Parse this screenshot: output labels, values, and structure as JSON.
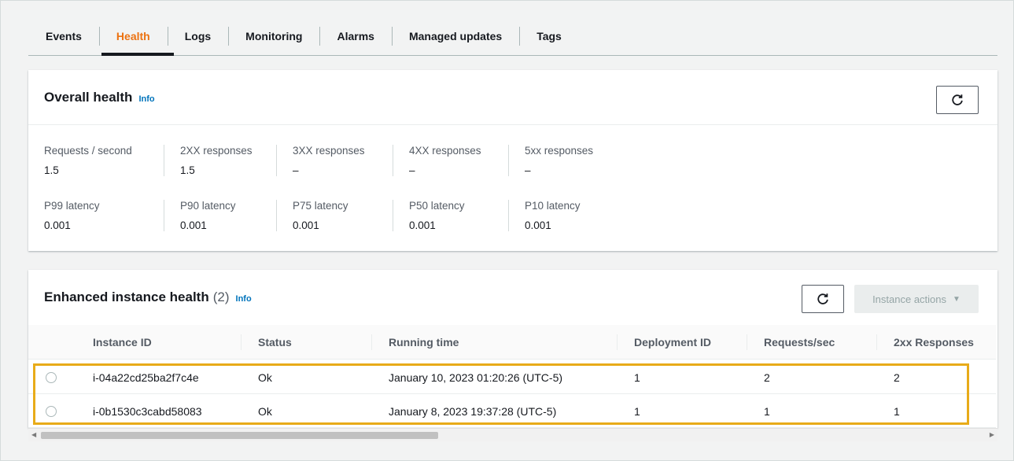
{
  "tabs": [
    {
      "label": "Events"
    },
    {
      "label": "Health"
    },
    {
      "label": "Logs"
    },
    {
      "label": "Monitoring"
    },
    {
      "label": "Alarms"
    },
    {
      "label": "Managed updates"
    },
    {
      "label": "Tags"
    }
  ],
  "overall": {
    "title": "Overall health",
    "info": "Info",
    "metrics_row1": [
      {
        "label": "Requests / second",
        "value": "1.5"
      },
      {
        "label": "2XX responses",
        "value": "1.5"
      },
      {
        "label": "3XX responses",
        "value": "–"
      },
      {
        "label": "4XX responses",
        "value": "–"
      },
      {
        "label": "5xx responses",
        "value": "–"
      }
    ],
    "metrics_row2": [
      {
        "label": "P99 latency",
        "value": "0.001"
      },
      {
        "label": "P90 latency",
        "value": "0.001"
      },
      {
        "label": "P75 latency",
        "value": "0.001"
      },
      {
        "label": "P50 latency",
        "value": "0.001"
      },
      {
        "label": "P10 latency",
        "value": "0.001"
      }
    ]
  },
  "enhanced": {
    "title": "Enhanced instance health",
    "count": "(2)",
    "info": "Info",
    "actions_label": "Instance actions",
    "columns": [
      "Instance ID",
      "Status",
      "Running time",
      "Deployment ID",
      "Requests/sec",
      "2xx Responses"
    ],
    "rows": [
      [
        "i-04a22cd25ba2f7c4e",
        "Ok",
        "January 10, 2023 01:20:26 (UTC-5)",
        "1",
        "2",
        "2"
      ],
      [
        "i-0b1530c3cabd58083",
        "Ok",
        "January 8, 2023 19:37:28 (UTC-5)",
        "1",
        "1",
        "1"
      ]
    ]
  },
  "colors": {
    "active_tab": "#ec7211",
    "highlight": "#e8ab19",
    "link": "#0073bb"
  }
}
